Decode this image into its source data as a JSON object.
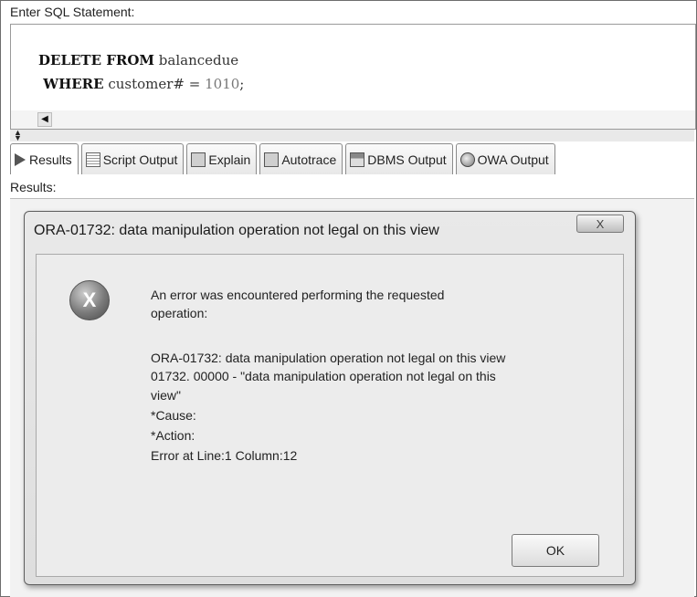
{
  "editor": {
    "label": "Enter SQL Statement:",
    "lines": [
      {
        "kw": "DELETE FROM",
        "rest": " balancedue",
        "num": ""
      },
      {
        "kw": " WHERE",
        "rest": " customer# = ",
        "num": "1010",
        "tail": ";"
      }
    ]
  },
  "tabs": [
    {
      "label": "Results",
      "icon": "play-icon"
    },
    {
      "label": "Script Output",
      "icon": "script-output-icon"
    },
    {
      "label": "Explain",
      "icon": "explain-icon"
    },
    {
      "label": "Autotrace",
      "icon": "autotrace-icon"
    },
    {
      "label": "DBMS Output",
      "icon": "dbms-output-icon"
    },
    {
      "label": "OWA Output",
      "icon": "owa-output-icon"
    }
  ],
  "results": {
    "label": "Results:"
  },
  "dialog": {
    "title": "ORA-01732: data manipulation operation not legal on this view",
    "close_symbol": "X",
    "icon_symbol": "X",
    "message_lines": [
      "An error was encountered performing the requested",
      "operation:",
      "",
      "ORA-01732: data manipulation operation not legal on this view",
      "01732. 00000 -  \"data manipulation operation not legal on this",
      "view\"",
      "*Cause:",
      "*Action:",
      "Error at Line:1 Column:12"
    ],
    "ok_label": "OK"
  }
}
